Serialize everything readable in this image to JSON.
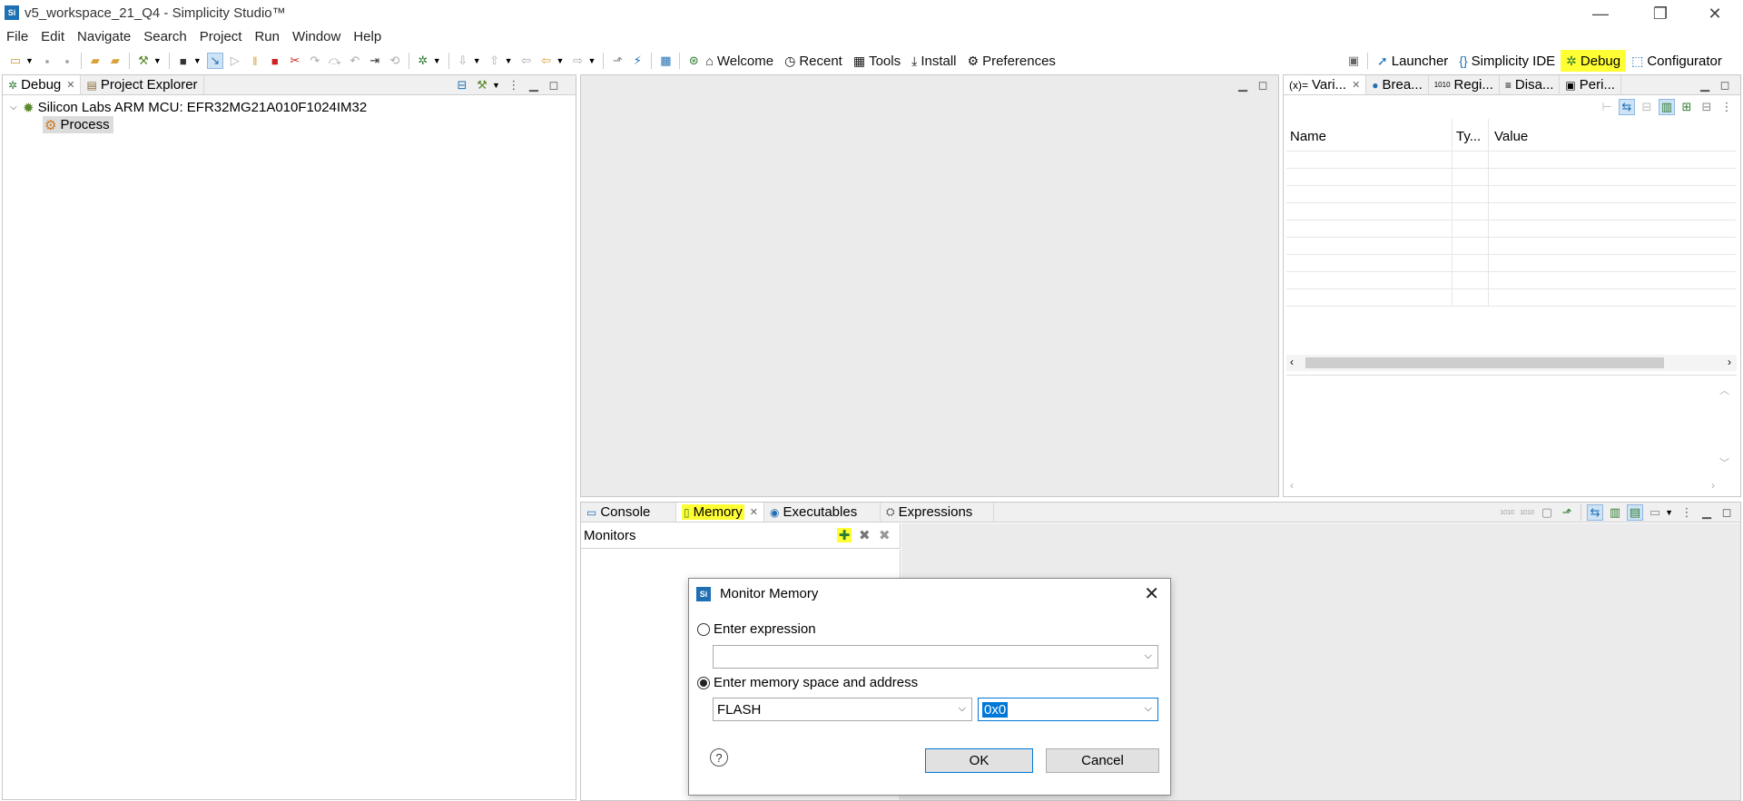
{
  "window": {
    "title": "v5_workspace_21_Q4 - Simplicity Studio™",
    "logo_text": "Si",
    "minimize_icon": "—",
    "restore_icon": "❐",
    "close_icon": "✕"
  },
  "menu": [
    "File",
    "Edit",
    "Navigate",
    "Search",
    "Project",
    "Run",
    "Window",
    "Help"
  ],
  "toolbar": {
    "nav_links": [
      {
        "label": "Welcome",
        "icon": "home-icon"
      },
      {
        "label": "Recent",
        "icon": "clock-icon"
      },
      {
        "label": "Tools",
        "icon": "grid-icon"
      },
      {
        "label": "Install",
        "icon": "download-icon"
      },
      {
        "label": "Preferences",
        "icon": "gear-icon"
      }
    ],
    "perspectives": [
      {
        "label": "Launcher",
        "icon": "rocket-icon",
        "highlighted": false
      },
      {
        "label": "Simplicity IDE",
        "icon": "braces-icon",
        "highlighted": false
      },
      {
        "label": "Debug",
        "icon": "bug-icon",
        "highlighted": true
      },
      {
        "label": "Configurator",
        "icon": "chip-icon",
        "highlighted": false
      }
    ]
  },
  "left_panel": {
    "tabs": [
      {
        "label": "Debug",
        "active": true,
        "closable": true
      },
      {
        "label": "Project Explorer",
        "active": false,
        "closable": false
      }
    ],
    "tree": {
      "root": "Silicon Labs ARM MCU: EFR32MG21A010F1024IM32",
      "child": "Process"
    }
  },
  "right_panel": {
    "tabs": [
      {
        "label": "Vari...",
        "icon": "(x)=",
        "active": true
      },
      {
        "label": "Brea...",
        "icon": "●"
      },
      {
        "label": "Regi...",
        "icon": "1010"
      },
      {
        "label": "Disa...",
        "icon": "≡"
      },
      {
        "label": "Peri...",
        "icon": "▣"
      }
    ],
    "columns": [
      "Name",
      "Ty...",
      "Value"
    ]
  },
  "bottom_panel": {
    "tabs": [
      {
        "label": "Console",
        "active": false
      },
      {
        "label": "Memory",
        "active": true,
        "highlighted": true
      },
      {
        "label": "Executables",
        "active": false
      },
      {
        "label": "Expressions",
        "active": false
      }
    ],
    "monitors_label": "Monitors"
  },
  "dialog": {
    "title": "Monitor Memory",
    "logo_text": "Si",
    "option_expression": "Enter expression",
    "expression_value": "",
    "option_memory": "Enter memory space and address",
    "memory_space": "FLASH",
    "address": "0x0",
    "selected_option": "memory",
    "ok_label": "OK",
    "cancel_label": "Cancel",
    "help_icon": "?"
  },
  "colors": {
    "highlight": "#ffff33",
    "selection": "#0078d7",
    "accent": "#1f6fb3"
  }
}
